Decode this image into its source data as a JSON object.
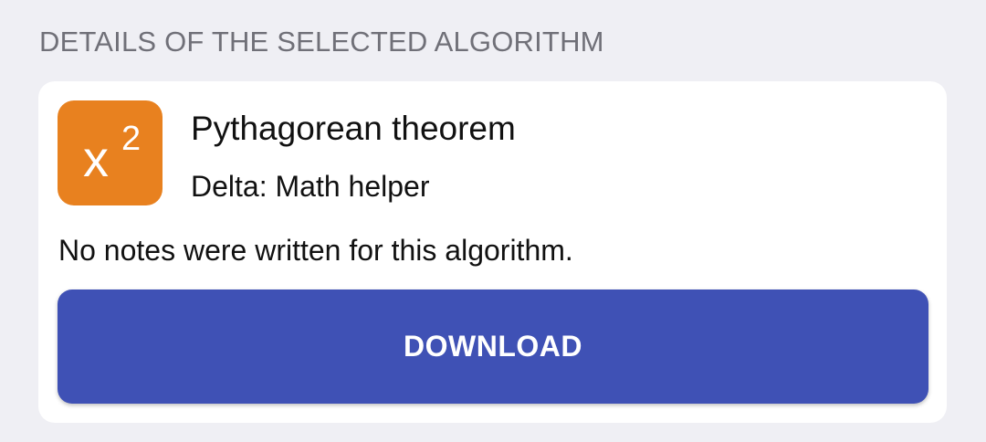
{
  "section": {
    "header": "DETAILS OF THE SELECTED ALGORITHM"
  },
  "algorithm": {
    "icon": {
      "name": "x-squared-icon",
      "base": "x",
      "exponent": "2",
      "background_color": "#e8811f"
    },
    "title": "Pythagorean theorem",
    "subtitle": "Delta: Math helper",
    "notes": "No notes were written for this algorithm."
  },
  "actions": {
    "download_label": "DOWNLOAD",
    "accent_color": "#3f51b5"
  }
}
